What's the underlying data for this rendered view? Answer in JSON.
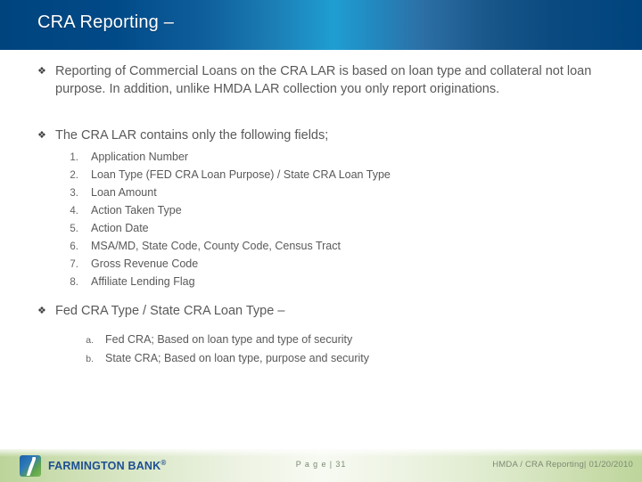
{
  "header": {
    "title": "CRA Reporting –",
    "accent_dark": "#00447e",
    "accent_light": "#1f9ed2"
  },
  "body": {
    "bullet_glyph": "❖",
    "bullets": [
      {
        "id": "bullet-commercial-loans",
        "text": "Reporting of Commercial Loans on the CRA LAR is based on loan type and collateral not loan purpose.  In addition, unlike HMDA LAR collection you only report originations."
      },
      {
        "id": "bullet-lar-fields",
        "text": "The CRA LAR contains only the following fields;"
      },
      {
        "id": "bullet-fed-state-type",
        "text": "Fed CRA Type / State CRA Loan Type –"
      }
    ],
    "numbered_list": [
      {
        "marker": "1.",
        "label": "Application Number"
      },
      {
        "marker": "2.",
        "label": "Loan Type (FED CRA Loan Purpose) / State CRA Loan Type"
      },
      {
        "marker": "3.",
        "label": "Loan Amount"
      },
      {
        "marker": "4.",
        "label": "Action Taken Type"
      },
      {
        "marker": "5.",
        "label": "Action Date"
      },
      {
        "marker": "6.",
        "label": "MSA/MD, State Code, County Code, Census Tract"
      },
      {
        "marker": "7.",
        "label": "Gross Revenue Code"
      },
      {
        "marker": "8.",
        "label": "Affiliate Lending Flag"
      }
    ],
    "alpha_list": [
      {
        "marker": "a.",
        "label": "Fed CRA; Based on loan type and type of security"
      },
      {
        "marker": "b.",
        "label": "State CRA; Based on loan type, purpose and security"
      }
    ]
  },
  "footer": {
    "logo_name": "FARMINGTON BANK",
    "logo_tm": "®",
    "page_label": "P a g e | 31",
    "right_text": "HMDA / CRA Reporting| 01/20/2010",
    "brand_blue": "#1d4f91",
    "brand_green": "#7cba53"
  }
}
